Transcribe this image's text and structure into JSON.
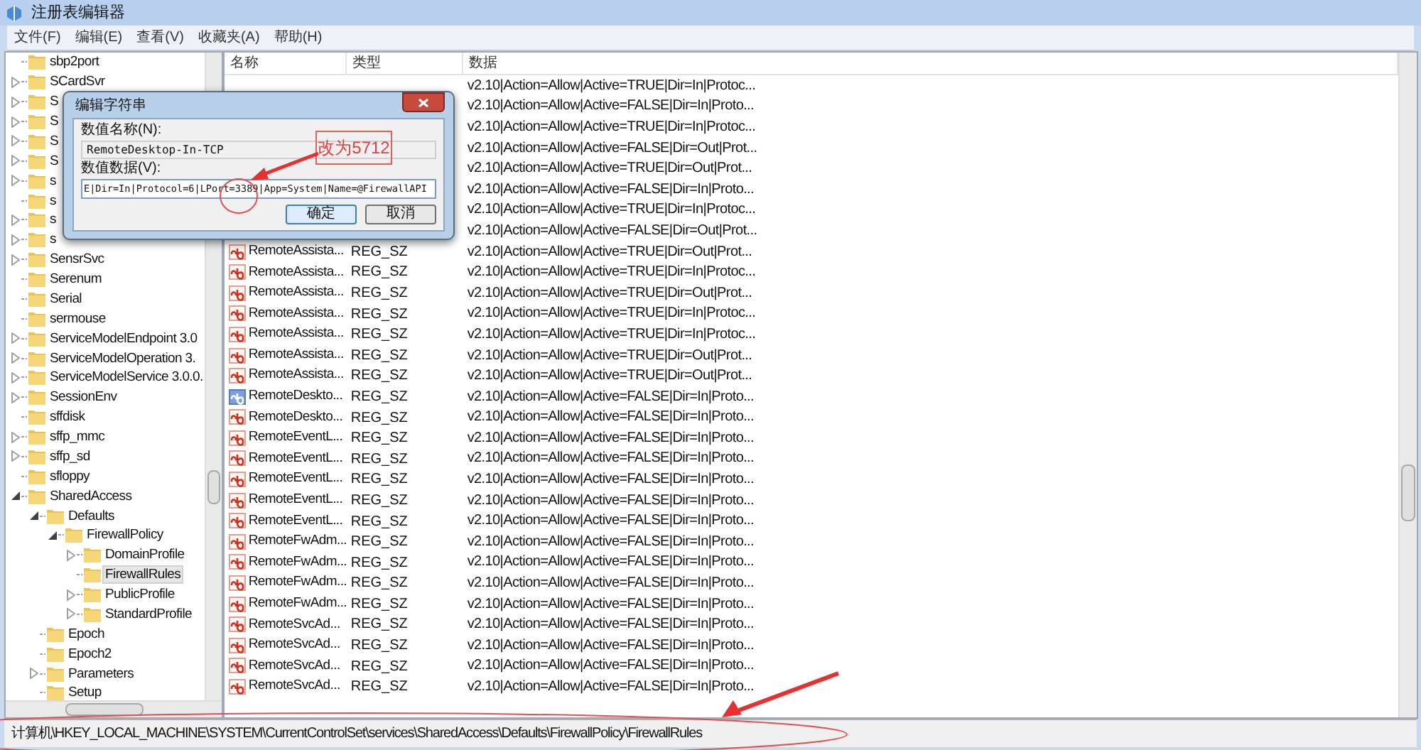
{
  "window": {
    "title": "注册表编辑器"
  },
  "menu": [
    "文件(F)",
    "编辑(E)",
    "查看(V)",
    "收藏夹(A)",
    "帮助(H)"
  ],
  "tree": [
    {
      "label": "sbp2port",
      "kind": "leaf",
      "selected": false
    },
    {
      "label": "SCardSvr",
      "kind": "collapsed",
      "selected": false
    },
    {
      "label": "S",
      "kind": "collapsed",
      "selected": false
    },
    {
      "label": "S",
      "kind": "collapsed",
      "selected": false
    },
    {
      "label": "S",
      "kind": "collapsed",
      "selected": false
    },
    {
      "label": "S",
      "kind": "collapsed",
      "selected": false
    },
    {
      "label": "s",
      "kind": "collapsed",
      "selected": false
    },
    {
      "label": "s",
      "kind": "leaf",
      "selected": false
    },
    {
      "label": "s",
      "kind": "collapsed",
      "selected": false
    },
    {
      "label": "s",
      "kind": "collapsed",
      "selected": false
    },
    {
      "label": "SensrSvc",
      "kind": "collapsed",
      "selected": false
    },
    {
      "label": "Serenum",
      "kind": "leaf",
      "selected": false
    },
    {
      "label": "Serial",
      "kind": "leaf",
      "selected": false
    },
    {
      "label": "sermouse",
      "kind": "leaf",
      "selected": false
    },
    {
      "label": "ServiceModelEndpoint 3.0",
      "kind": "collapsed",
      "selected": false
    },
    {
      "label": "ServiceModelOperation 3.",
      "kind": "collapsed",
      "selected": false
    },
    {
      "label": "ServiceModelService 3.0.0.",
      "kind": "collapsed",
      "selected": false
    },
    {
      "label": "SessionEnv",
      "kind": "collapsed",
      "selected": false
    },
    {
      "label": "sffdisk",
      "kind": "leaf",
      "selected": false
    },
    {
      "label": "sffp_mmc",
      "kind": "collapsed",
      "selected": false
    },
    {
      "label": "sffp_sd",
      "kind": "collapsed",
      "selected": false
    },
    {
      "label": "sfloppy",
      "kind": "leaf",
      "selected": false
    },
    {
      "label": "SharedAccess",
      "kind": "expanded",
      "selected": false,
      "children": [
        {
          "label": "Defaults",
          "kind": "expanded",
          "selected": false,
          "children": [
            {
              "label": "FirewallPolicy",
              "kind": "expanded",
              "selected": false,
              "children": [
                {
                  "label": "DomainProfile",
                  "kind": "collapsed",
                  "selected": false
                },
                {
                  "label": "FirewallRules",
                  "kind": "leaf",
                  "selected": true
                },
                {
                  "label": "PublicProfile",
                  "kind": "collapsed",
                  "selected": false
                },
                {
                  "label": "StandardProfile",
                  "kind": "collapsed",
                  "selected": false
                }
              ]
            }
          ]
        },
        {
          "label": "Epoch",
          "kind": "leaf",
          "selected": false
        },
        {
          "label": "Epoch2",
          "kind": "leaf",
          "selected": false
        },
        {
          "label": "Parameters",
          "kind": "collapsed",
          "selected": false
        },
        {
          "label": "Setup",
          "kind": "leaf",
          "selected": false
        }
      ]
    }
  ],
  "table": {
    "columns": [
      "名称",
      "类型",
      "数据"
    ],
    "rows": [
      {
        "data": "v2.10|Action=Allow|Active=TRUE|Dir=In|Protoc..."
      },
      {
        "data": "v2.10|Action=Allow|Active=FALSE|Dir=In|Proto..."
      },
      {
        "data": "v2.10|Action=Allow|Active=TRUE|Dir=In|Protoc..."
      },
      {
        "data": "v2.10|Action=Allow|Active=FALSE|Dir=Out|Prot..."
      },
      {
        "data": "v2.10|Action=Allow|Active=TRUE|Dir=Out|Prot..."
      },
      {
        "data": "v2.10|Action=Allow|Active=FALSE|Dir=In|Proto..."
      },
      {
        "data": "v2.10|Action=Allow|Active=TRUE|Dir=In|Protoc..."
      },
      {
        "data": "v2.10|Action=Allow|Active=FALSE|Dir=Out|Prot..."
      },
      {
        "kind": "string",
        "name": "RemoteAssista...",
        "type": "REG_SZ",
        "data": "v2.10|Action=Allow|Active=TRUE|Dir=Out|Prot..."
      },
      {
        "kind": "string",
        "name": "RemoteAssista...",
        "type": "REG_SZ",
        "data": "v2.10|Action=Allow|Active=TRUE|Dir=In|Protoc..."
      },
      {
        "kind": "string",
        "name": "RemoteAssista...",
        "type": "REG_SZ",
        "data": "v2.10|Action=Allow|Active=TRUE|Dir=Out|Prot..."
      },
      {
        "kind": "string",
        "name": "RemoteAssista...",
        "type": "REG_SZ",
        "data": "v2.10|Action=Allow|Active=TRUE|Dir=In|Protoc..."
      },
      {
        "kind": "string",
        "name": "RemoteAssista...",
        "type": "REG_SZ",
        "data": "v2.10|Action=Allow|Active=TRUE|Dir=In|Protoc..."
      },
      {
        "kind": "string",
        "name": "RemoteAssista...",
        "type": "REG_SZ",
        "data": "v2.10|Action=Allow|Active=TRUE|Dir=Out|Prot..."
      },
      {
        "kind": "string",
        "name": "RemoteAssista...",
        "type": "REG_SZ",
        "data": "v2.10|Action=Allow|Active=TRUE|Dir=Out|Prot..."
      },
      {
        "kind": "editing",
        "name": "RemoteDeskto...",
        "type": "REG_SZ",
        "data": "v2.10|Action=Allow|Active=FALSE|Dir=In|Proto..."
      },
      {
        "kind": "string",
        "name": "RemoteDeskto...",
        "type": "REG_SZ",
        "data": "v2.10|Action=Allow|Active=FALSE|Dir=In|Proto..."
      },
      {
        "kind": "string",
        "name": "RemoteEventL...",
        "type": "REG_SZ",
        "data": "v2.10|Action=Allow|Active=FALSE|Dir=In|Proto..."
      },
      {
        "kind": "string",
        "name": "RemoteEventL...",
        "type": "REG_SZ",
        "data": "v2.10|Action=Allow|Active=FALSE|Dir=In|Proto..."
      },
      {
        "kind": "string",
        "name": "RemoteEventL...",
        "type": "REG_SZ",
        "data": "v2.10|Action=Allow|Active=FALSE|Dir=In|Proto..."
      },
      {
        "kind": "string",
        "name": "RemoteEventL...",
        "type": "REG_SZ",
        "data": "v2.10|Action=Allow|Active=FALSE|Dir=In|Proto..."
      },
      {
        "kind": "string",
        "name": "RemoteEventL...",
        "type": "REG_SZ",
        "data": "v2.10|Action=Allow|Active=FALSE|Dir=In|Proto..."
      },
      {
        "kind": "string",
        "name": "RemoteFwAdm...",
        "type": "REG_SZ",
        "data": "v2.10|Action=Allow|Active=FALSE|Dir=In|Proto..."
      },
      {
        "kind": "string",
        "name": "RemoteFwAdm...",
        "type": "REG_SZ",
        "data": "v2.10|Action=Allow|Active=FALSE|Dir=In|Proto..."
      },
      {
        "kind": "string",
        "name": "RemoteFwAdm...",
        "type": "REG_SZ",
        "data": "v2.10|Action=Allow|Active=FALSE|Dir=In|Proto..."
      },
      {
        "kind": "string",
        "name": "RemoteFwAdm...",
        "type": "REG_SZ",
        "data": "v2.10|Action=Allow|Active=FALSE|Dir=In|Proto..."
      },
      {
        "kind": "string",
        "name": "RemoteSvcAd...",
        "type": "REG_SZ",
        "data": "v2.10|Action=Allow|Active=FALSE|Dir=In|Proto..."
      },
      {
        "kind": "string",
        "name": "RemoteSvcAd...",
        "type": "REG_SZ",
        "data": "v2.10|Action=Allow|Active=FALSE|Dir=In|Proto..."
      },
      {
        "kind": "string",
        "name": "RemoteSvcAd...",
        "type": "REG_SZ",
        "data": "v2.10|Action=Allow|Active=FALSE|Dir=In|Proto..."
      },
      {
        "kind": "string",
        "name": "RemoteSvcAd...",
        "type": "REG_SZ",
        "data": "v2.10|Action=Allow|Active=FALSE|Dir=In|Proto..."
      }
    ]
  },
  "dialog": {
    "title": "编辑字符串",
    "name_label": "数值名称(N):",
    "name_value": "RemoteDesktop-In-TCP",
    "data_label": "数值数据(V):",
    "data_value": "E|Dir=In|Protocol=6|LPort=3389|App=System|Name=@FirewallAPI",
    "buttons": [
      {
        "label": "确定",
        "focused": true
      },
      {
        "label": "取消",
        "focused": false
      }
    ]
  },
  "annotation": {
    "note": "改为5712"
  },
  "status_bar": "计算机\\HKEY_LOCAL_MACHINE\\SYSTEM\\CurrentControlSet\\services\\SharedAccess\\Defaults\\FirewallPolicy\\FirewallRules"
}
